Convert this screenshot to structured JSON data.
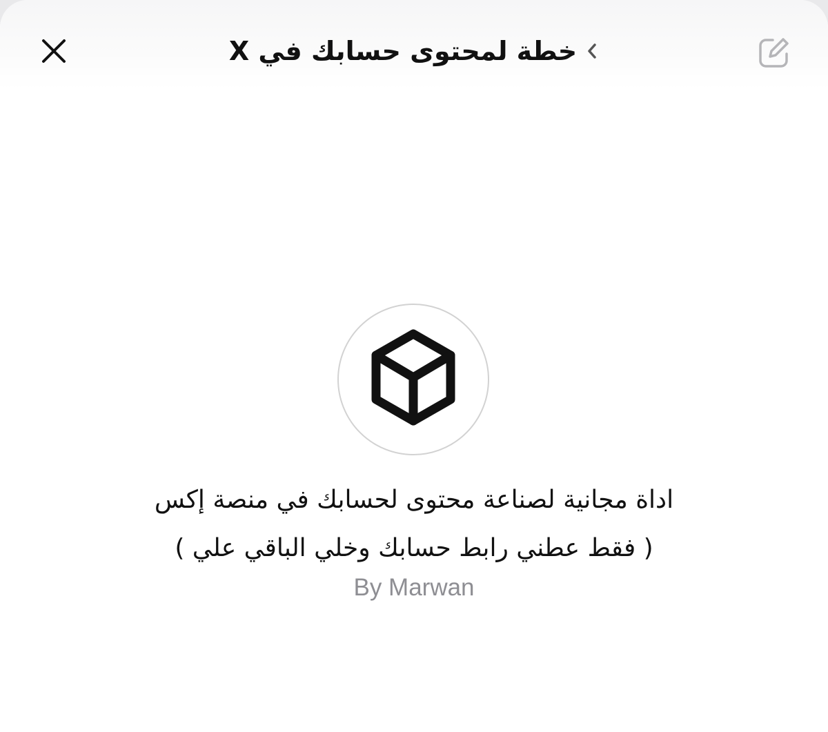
{
  "header": {
    "title": "خطة لمحتوى حسابك في X",
    "close_icon": "close-icon",
    "chevron_icon": "chevron-icon",
    "edit_icon": "compose-icon"
  },
  "main": {
    "hero_icon": "cube-icon",
    "description_line1": "اداة مجانية لصناعة محتوى لحسابك في منصة إكس",
    "description_line2": "( فقط عطني رابط حسابك وخلي الباقي علي )",
    "author": "By Marwan"
  },
  "colors": {
    "background": "#ffffff",
    "text": "#111111",
    "muted_text": "#8e8e93",
    "circle_border": "#d2d2d2",
    "disabled_icon": "#b5b5b8"
  }
}
